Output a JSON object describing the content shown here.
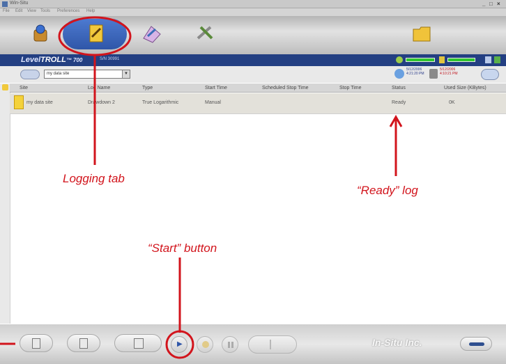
{
  "window": {
    "title": "Win-Situ",
    "controls": [
      "_",
      "□",
      "×"
    ]
  },
  "menu": [
    "File",
    "Edit",
    "View",
    "Tools",
    "Preferences",
    "Help"
  ],
  "tabs": [
    {
      "name": "connection",
      "icon": "instrument-icon"
    },
    {
      "name": "logging",
      "icon": "logging-icon",
      "active": true
    },
    {
      "name": "data",
      "icon": "data-icon"
    },
    {
      "name": "utilities",
      "icon": "tools-icon"
    },
    {
      "name": "folder",
      "icon": "folder-icon"
    }
  ],
  "header": {
    "brand_prefix": "Level",
    "brand_main": "TROLL",
    "brand_suffix": "™ 700",
    "serial": "S/N 30991"
  },
  "site_selector": {
    "value": "my data site"
  },
  "clock": {
    "pc_date": "5/12/2006",
    "pc_time": "4:21:20 PM",
    "device_date": "5/12/2006",
    "device_time": "4:10:21 PM"
  },
  "table": {
    "columns": [
      "Site",
      "Log Name",
      "Type",
      "Start Time",
      "Scheduled Stop Time",
      "Stop Time",
      "Status",
      "Used Size (KBytes)"
    ],
    "rows": [
      {
        "site": "my data site",
        "log_name": "Drawdown 2",
        "type": "True Logarithmic",
        "start_time": "Manual",
        "scheduled_stop": "",
        "stop_time": "",
        "status": "Ready",
        "used_size": "0K"
      }
    ]
  },
  "annotations": {
    "logging_tab": "Logging tab",
    "ready_log": "“Ready” log",
    "start_button": "“Start” button"
  },
  "footer": {
    "logo": "In-Situ Inc."
  },
  "colors": {
    "annotation": "#d2141c",
    "header_bg": "#233f82",
    "active_tab": "#3561b8"
  }
}
